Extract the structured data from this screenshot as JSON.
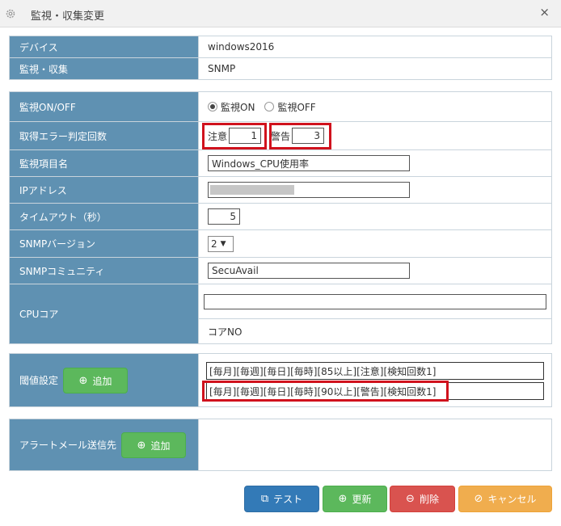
{
  "window": {
    "title": "監視・収集変更",
    "settings_icon": "gear-icon",
    "close_glyph": "×"
  },
  "info": [
    {
      "label": "デバイス",
      "value": "windows2016"
    },
    {
      "label": "監視・収集",
      "value": "SNMP"
    }
  ],
  "monitor": {
    "label": "監視ON/OFF",
    "on_label": "監視ON",
    "off_label": "監視OFF",
    "selected": "on"
  },
  "error_count": {
    "label": "取得エラー判定回数",
    "caution_label": "注意",
    "caution_value": "1",
    "warning_label": "警告",
    "warning_value": "3"
  },
  "item_name": {
    "label": "監視項目名",
    "value": "Windows_CPU使用率"
  },
  "ip": {
    "label": "IPアドレス",
    "value": ""
  },
  "timeout": {
    "label": "タイムアウト（秒）",
    "value": "5"
  },
  "snmp_version": {
    "label": "SNMPバージョン",
    "value": "2"
  },
  "snmp_community": {
    "label": "SNMPコミュニティ",
    "value": "SecuAvail"
  },
  "cpu_core": {
    "label": "CPUコア",
    "value": "",
    "caption": "コアNO"
  },
  "threshold": {
    "label": "閾値設定",
    "add_label": "追加",
    "lines": [
      "[毎月][毎週][毎日][毎時][85以上][注意][検知回数1]",
      "[毎月][毎週][毎日][毎時][90以上][警告][検知回数1]"
    ]
  },
  "alert_mail": {
    "label": "アラートメール送信先",
    "add_label": "追加"
  },
  "actions": {
    "test": "テスト",
    "update": "更新",
    "delete": "削除",
    "cancel": "キャンセル"
  },
  "colors": {
    "label_bg": "#5f91b2",
    "highlight": "#d0121d",
    "green": "#5cb85c",
    "blue": "#337ab7",
    "red": "#d9534f",
    "orange": "#f0ad4e"
  }
}
